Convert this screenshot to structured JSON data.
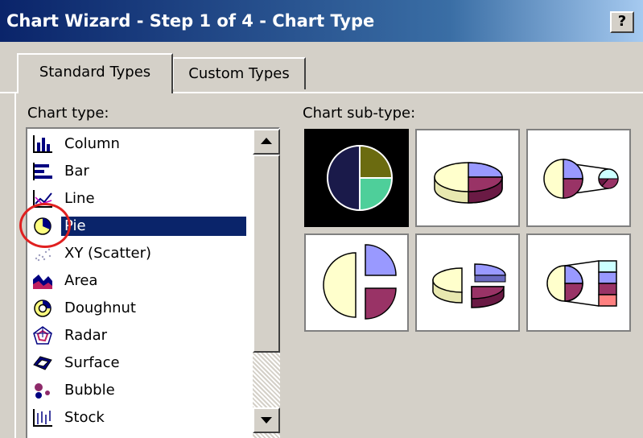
{
  "window": {
    "title": "Chart Wizard - Step 1 of 4 - Chart Type",
    "help_label": "?"
  },
  "tabs": [
    {
      "label": "Standard Types",
      "active": true
    },
    {
      "label": "Custom Types",
      "active": false
    }
  ],
  "chart_type": {
    "label": "Chart type:",
    "items": [
      {
        "label": "Column",
        "icon": "column-chart-icon"
      },
      {
        "label": "Bar",
        "icon": "bar-chart-icon"
      },
      {
        "label": "Line",
        "icon": "line-chart-icon"
      },
      {
        "label": "Pie",
        "icon": "pie-chart-icon",
        "selected": true
      },
      {
        "label": "XY (Scatter)",
        "icon": "scatter-chart-icon"
      },
      {
        "label": "Area",
        "icon": "area-chart-icon"
      },
      {
        "label": "Doughnut",
        "icon": "doughnut-chart-icon"
      },
      {
        "label": "Radar",
        "icon": "radar-chart-icon"
      },
      {
        "label": "Surface",
        "icon": "surface-chart-icon"
      },
      {
        "label": "Bubble",
        "icon": "bubble-chart-icon"
      },
      {
        "label": "Stock",
        "icon": "stock-chart-icon"
      }
    ]
  },
  "chart_subtype": {
    "label": "Chart sub-type:",
    "tiles": [
      {
        "name": "pie",
        "selected": true
      },
      {
        "name": "3d-pie"
      },
      {
        "name": "pie-of-pie"
      },
      {
        "name": "exploded-pie"
      },
      {
        "name": "exploded-3d-pie"
      },
      {
        "name": "bar-of-pie"
      }
    ]
  },
  "colors": {
    "titlebar_start": "#0a246a",
    "selection": "#0a246a",
    "annotation_circle": "#e02020",
    "pie_navy": "#1a1a4a",
    "pie_olive": "#6b6b10",
    "pie_teal": "#4ecf9a",
    "pie_periwinkle": "#9999ff",
    "pie_plum": "#993366",
    "pie_cream": "#ffffcc",
    "pie_lightblue": "#ccffff"
  }
}
